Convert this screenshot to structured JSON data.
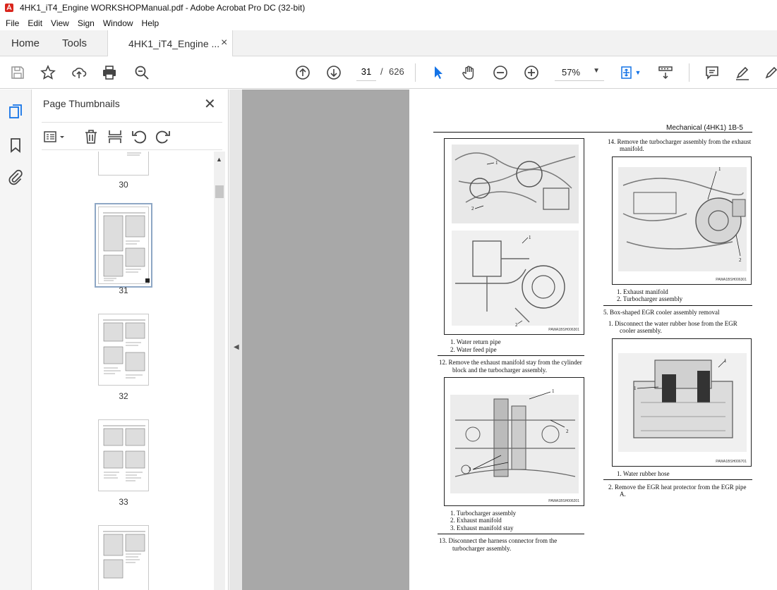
{
  "window": {
    "title": "4HK1_iT4_Engine WORKSHOPManual.pdf - Adobe Acrobat Pro DC (32-bit)"
  },
  "menu": [
    "File",
    "Edit",
    "View",
    "Sign",
    "Window",
    "Help"
  ],
  "tabs": {
    "home": "Home",
    "tools": "Tools",
    "document": "4HK1_iT4_Engine ...",
    "close": "×"
  },
  "toolbar": {
    "icons": [
      "save-icon",
      "star-icon",
      "upload-icon",
      "print-icon",
      "find-icon",
      "page-up-icon",
      "page-down-icon",
      "cursor-icon",
      "hand-icon",
      "zoom-out-icon",
      "zoom-in-icon",
      "zoom-dropdown",
      "fit-page-icon",
      "scroll-mode-icon",
      "comment-icon",
      "highlight-icon",
      "sign-icon"
    ],
    "current_page": "31",
    "separator": "/",
    "total_pages": "626",
    "zoom": "57%"
  },
  "panel": {
    "title": "Page Thumbnails",
    "thumbnails": [
      {
        "num": "30",
        "selected": false
      },
      {
        "num": "31",
        "selected": true
      },
      {
        "num": "32",
        "selected": false
      },
      {
        "num": "33",
        "selected": false
      },
      {
        "num": "",
        "selected": false
      }
    ]
  },
  "document": {
    "header": "Mechanical (4HK1)   1B-5",
    "left_col": {
      "fig1_code": "PAWA1BSH006301",
      "fig1_items": [
        "1.   Water return pipe",
        "2.   Water feed pipe"
      ],
      "step12": [
        "12.   Remove the exhaust manifold stay from the cylinder",
        "block and the turbocharger assembly."
      ],
      "fig2_code": "PAWA1BSH006201",
      "fig2_items": [
        "1.   Turbocharger assembly",
        "2.   Exhaust manifold",
        "3.   Exhaust manifold stay"
      ],
      "step13": [
        "13.   Disconnect the harness connector from the",
        "turbocharger assembly."
      ]
    },
    "right_col": {
      "step14": [
        "14.   Remove the turbocharger assembly from the exhaust",
        "manifold."
      ],
      "fig3_code": "PAWA1BSH006301",
      "fig3_items": [
        "1.   Exhaust manifold",
        "2.   Turbocharger assembly"
      ],
      "step5": "5.   Box-shaped EGR cooler assembly  removal",
      "step5_1": [
        "1.   Disconnect the water rubber hose from the EGR",
        "cooler assembly."
      ],
      "fig4_code": "PAWA1BSH006701",
      "fig4_items": [
        "1.   Water rubber hose"
      ],
      "step5_2": [
        "2.   Remove the EGR heat protector from the EGR pipe",
        "A."
      ]
    }
  }
}
